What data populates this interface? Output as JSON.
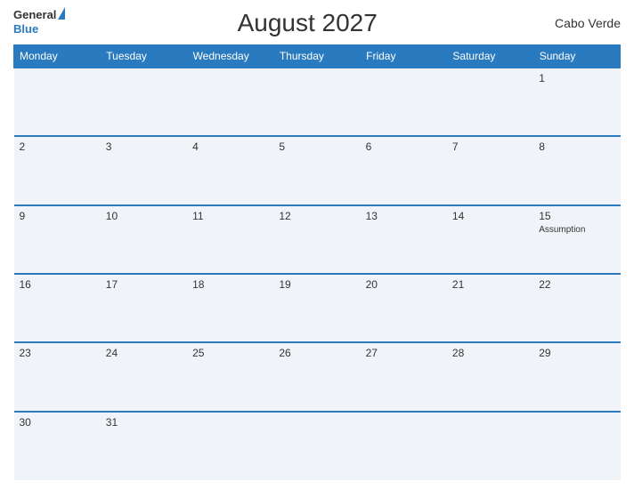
{
  "header": {
    "logo_general": "General",
    "logo_blue": "Blue",
    "title": "August 2027",
    "country": "Cabo Verde"
  },
  "weekdays": [
    "Monday",
    "Tuesday",
    "Wednesday",
    "Thursday",
    "Friday",
    "Saturday",
    "Sunday"
  ],
  "weeks": [
    [
      {
        "day": "",
        "event": ""
      },
      {
        "day": "",
        "event": ""
      },
      {
        "day": "",
        "event": ""
      },
      {
        "day": "",
        "event": ""
      },
      {
        "day": "",
        "event": ""
      },
      {
        "day": "",
        "event": ""
      },
      {
        "day": "1",
        "event": ""
      }
    ],
    [
      {
        "day": "2",
        "event": ""
      },
      {
        "day": "3",
        "event": ""
      },
      {
        "day": "4",
        "event": ""
      },
      {
        "day": "5",
        "event": ""
      },
      {
        "day": "6",
        "event": ""
      },
      {
        "day": "7",
        "event": ""
      },
      {
        "day": "8",
        "event": ""
      }
    ],
    [
      {
        "day": "9",
        "event": ""
      },
      {
        "day": "10",
        "event": ""
      },
      {
        "day": "11",
        "event": ""
      },
      {
        "day": "12",
        "event": ""
      },
      {
        "day": "13",
        "event": ""
      },
      {
        "day": "14",
        "event": ""
      },
      {
        "day": "15",
        "event": "Assumption"
      }
    ],
    [
      {
        "day": "16",
        "event": ""
      },
      {
        "day": "17",
        "event": ""
      },
      {
        "day": "18",
        "event": ""
      },
      {
        "day": "19",
        "event": ""
      },
      {
        "day": "20",
        "event": ""
      },
      {
        "day": "21",
        "event": ""
      },
      {
        "day": "22",
        "event": ""
      }
    ],
    [
      {
        "day": "23",
        "event": ""
      },
      {
        "day": "24",
        "event": ""
      },
      {
        "day": "25",
        "event": ""
      },
      {
        "day": "26",
        "event": ""
      },
      {
        "day": "27",
        "event": ""
      },
      {
        "day": "28",
        "event": ""
      },
      {
        "day": "29",
        "event": ""
      }
    ],
    [
      {
        "day": "30",
        "event": ""
      },
      {
        "day": "31",
        "event": ""
      },
      {
        "day": "",
        "event": ""
      },
      {
        "day": "",
        "event": ""
      },
      {
        "day": "",
        "event": ""
      },
      {
        "day": "",
        "event": ""
      },
      {
        "day": "",
        "event": ""
      }
    ]
  ]
}
